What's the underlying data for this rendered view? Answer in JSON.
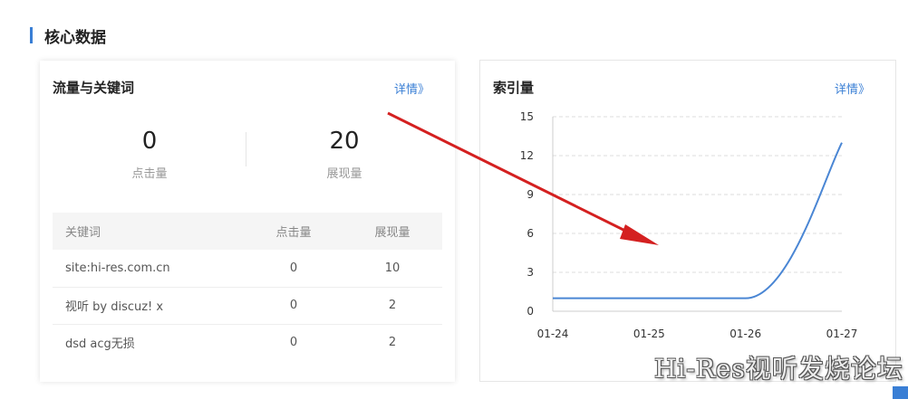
{
  "section": {
    "title": "核心数据"
  },
  "traffic": {
    "title": "流量与关键词",
    "detail_label": "详情》",
    "stats": [
      {
        "value": "0",
        "label": "点击量"
      },
      {
        "value": "20",
        "label": "展现量"
      }
    ],
    "table": {
      "headers": {
        "keyword": "关键词",
        "clicks": "点击量",
        "impressions": "展现量"
      },
      "rows": [
        {
          "keyword": "site:hi-res.com.cn",
          "clicks": "0",
          "impressions": "10"
        },
        {
          "keyword": "视听 by discuz! x",
          "clicks": "0",
          "impressions": "2"
        },
        {
          "keyword": "dsd acg无损",
          "clicks": "0",
          "impressions": "2"
        }
      ]
    }
  },
  "index": {
    "title": "索引量",
    "detail_label": "详情》"
  },
  "chart_data": {
    "type": "line",
    "title": "索引量",
    "x": [
      "01-24",
      "01-25",
      "01-26",
      "01-27"
    ],
    "series": [
      {
        "values": [
          1,
          1,
          1,
          13
        ]
      }
    ],
    "ylim": [
      0,
      15
    ],
    "yticks": [
      0,
      3,
      6,
      9,
      12,
      15
    ],
    "grid": true,
    "line_color": "#4a86d4"
  },
  "watermark": "Hi-Res视听发烧论坛",
  "colors": {
    "accent": "#3a7fd5",
    "annotation_arrow": "#d42020"
  }
}
